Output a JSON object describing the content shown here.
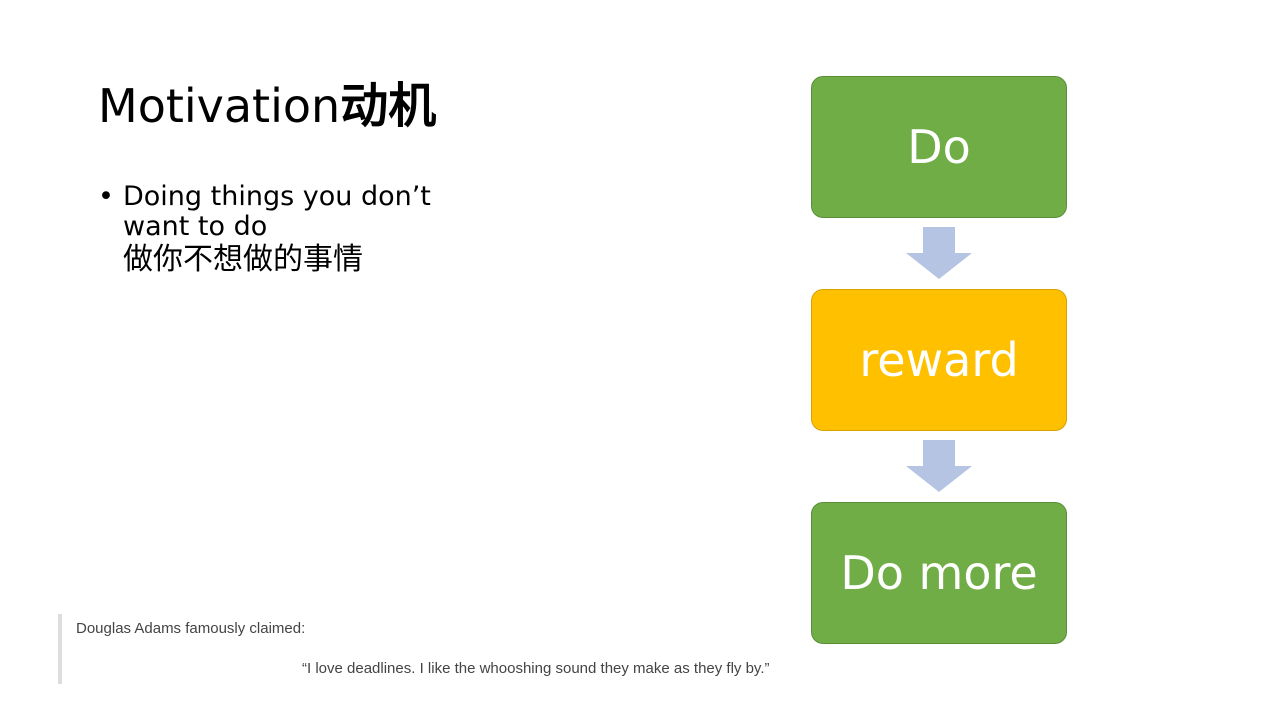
{
  "slide": {
    "title_en": "Motivation",
    "title_zh": "动机",
    "bullet": {
      "marker": "•",
      "line1": "Doing things you don’t",
      "line2": "want to do",
      "line3": "做你不想做的事情"
    }
  },
  "flow": {
    "steps": [
      {
        "label": "Do",
        "color": "#70ad47"
      },
      {
        "label": "reward",
        "color": "#ffc000"
      },
      {
        "label": "Do more",
        "color": "#70ad47"
      }
    ],
    "arrow_color": "#b4c4e2"
  },
  "quote": {
    "intro": "Douglas Adams famously claimed:",
    "text": "“I love deadlines. I like the whooshing sound they make as they fly by.”"
  }
}
